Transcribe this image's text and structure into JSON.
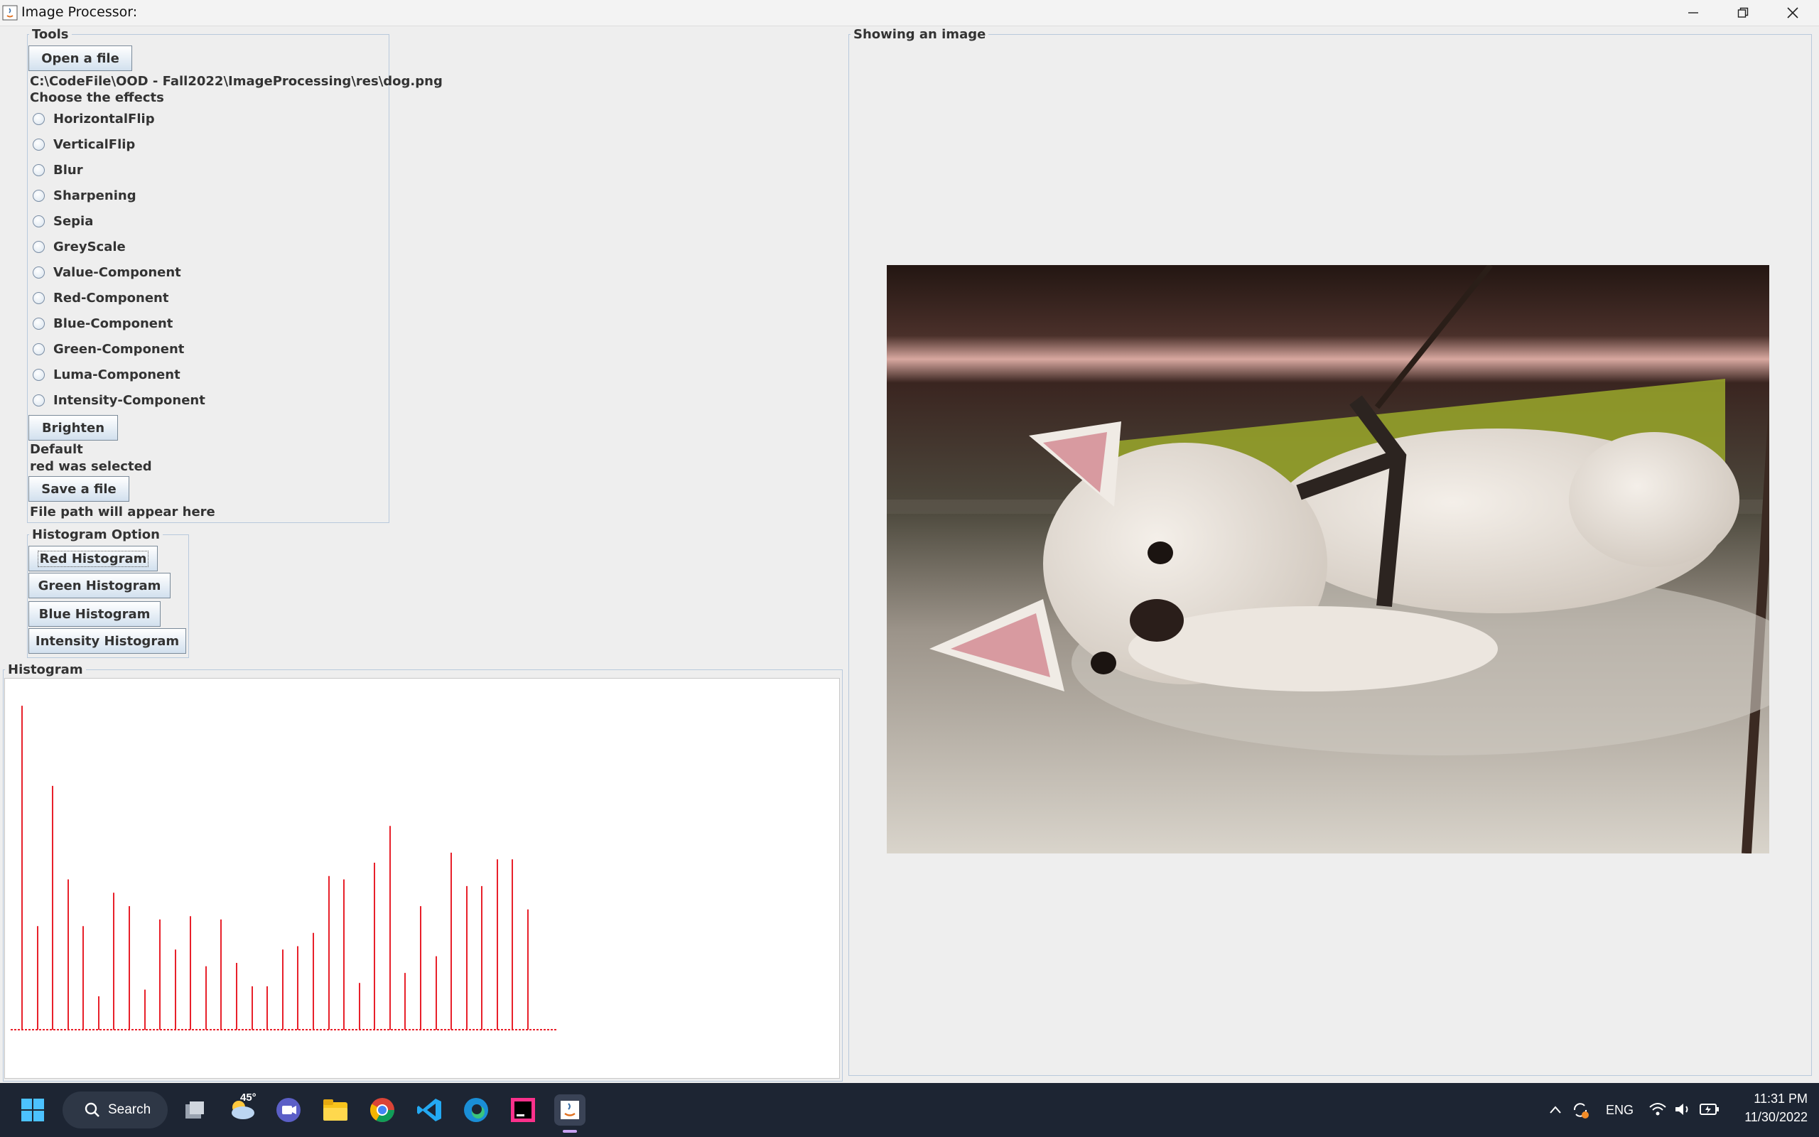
{
  "window": {
    "title": "Image Processor:"
  },
  "tools": {
    "legend": "Tools",
    "open_label": "Open a file",
    "file_path": "C:\\CodeFile\\OOD - Fall2022\\ImageProcessing\\res\\dog.png",
    "choose_label": "Choose the effects",
    "effects": [
      "HorizontalFlip",
      "VerticalFlip",
      "Blur",
      "Sharpening",
      "Sepia",
      "GreyScale",
      "Value-Component",
      "Red-Component",
      "Blue-Component",
      "Green-Component",
      "Luma-Component",
      "Intensity-Component"
    ],
    "brighten_label": "Brighten",
    "status_default": "Default",
    "status_selected": "red was selected",
    "save_label": "Save a file",
    "save_path_text": "File path will appear here"
  },
  "histogram_option": {
    "legend": "Histogram Option",
    "buttons": [
      "Red Histogram",
      "Green Histogram",
      "Blue Histogram",
      "Intensity Histogram"
    ]
  },
  "histogram": {
    "legend": "Histogram",
    "color": "#e8202a",
    "bars": [
      0.97,
      0.31,
      0.73,
      0.45,
      0.31,
      0.1,
      0.41,
      0.37,
      0.12,
      0.33,
      0.24,
      0.34,
      0.19,
      0.33,
      0.2,
      0.13,
      0.13,
      0.24,
      0.25,
      0.29,
      0.46,
      0.45,
      0.14,
      0.5,
      0.61,
      0.17,
      0.37,
      0.22,
      0.53,
      0.43,
      0.43,
      0.51,
      0.51,
      0.36
    ]
  },
  "image_panel": {
    "legend": "Showing an image",
    "image_alt": "dog.png"
  },
  "taskbar": {
    "search_label": "Search",
    "weather": "45°"
  },
  "tray": {
    "lang": "ENG",
    "time": "11:31 PM",
    "date": "11/30/2022"
  }
}
